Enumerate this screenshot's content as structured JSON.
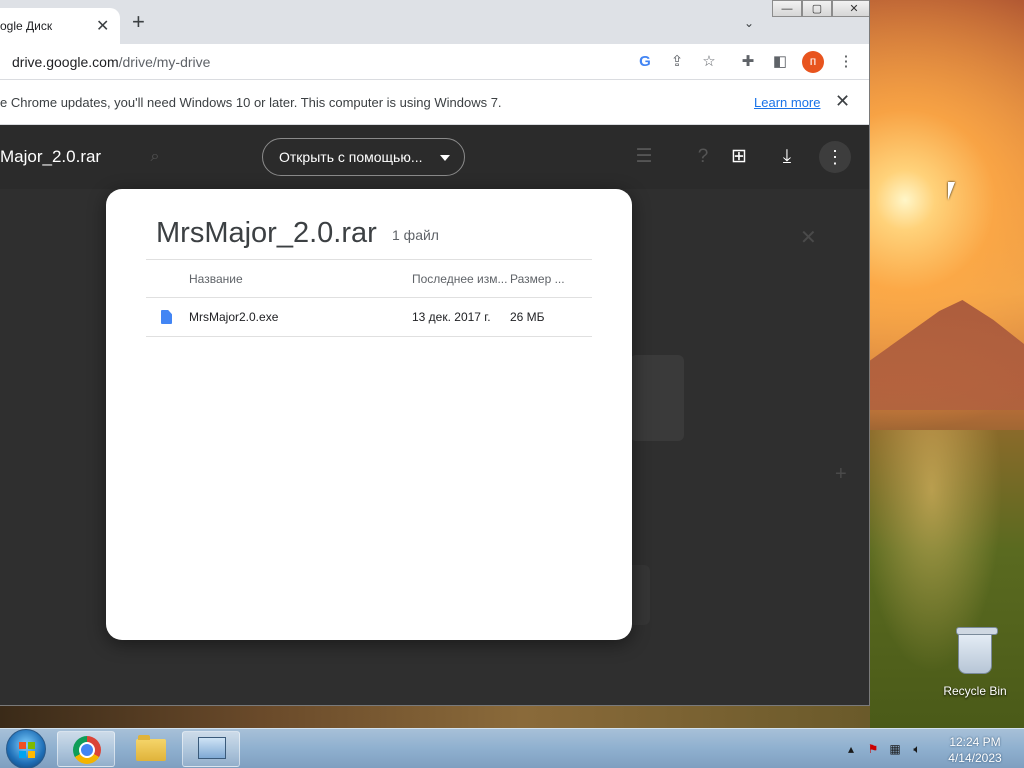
{
  "browser": {
    "tab_title": "ogle Диск",
    "url_host": "drive.google.com",
    "url_path": "/drive/my-drive",
    "avatar_letter": "п",
    "window_buttons": {
      "minimize": "—",
      "maximize": "▢",
      "close": "✕"
    }
  },
  "infobar": {
    "message": "e Chrome updates, you'll need Windows 10 or later. This computer is using Windows 7.",
    "learn_more": "Learn more"
  },
  "viewer": {
    "file_title": "Major_2.0.rar",
    "open_with": "Открыть с помощью..."
  },
  "dialog": {
    "title": "MrsMajor_2.0.rar",
    "count": "1 файл",
    "columns": {
      "name": "Название",
      "modified": "Последнее изм...",
      "size": "Размер ..."
    },
    "rows": [
      {
        "name": "MrsMajor2.0.exe",
        "modified": "13 дек. 2017 г.",
        "size": "26 МБ"
      }
    ]
  },
  "desktop": {
    "recycle_bin": "Recycle Bin"
  },
  "taskbar": {
    "time": "12:24 PM",
    "date": "4/14/2023"
  },
  "colors": {
    "accent": "#1a73e8",
    "avatar_bg": "#e8541e",
    "file_icon": "#4285f4"
  }
}
